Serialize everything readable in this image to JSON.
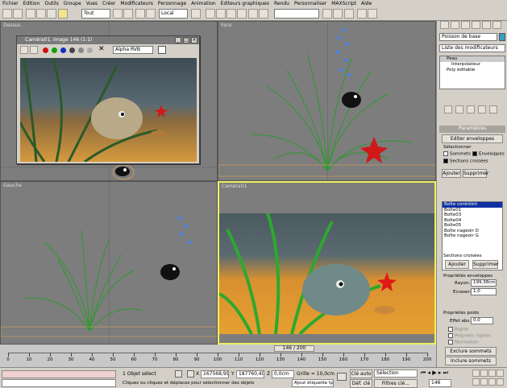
{
  "menu": [
    "Fichier",
    "Edition",
    "Outils",
    "Groupe",
    "Vues",
    "Créer",
    "Modificateurs",
    "Personnage",
    "Animation",
    "Editeurs graphiques",
    "Rendu",
    "Personnaliser",
    "MAXScript",
    "Aide"
  ],
  "toolbar": {
    "selection_filter": "Tout",
    "coord_system": "Local"
  },
  "viewports": {
    "top_left": "Dessus",
    "top_right": "Face",
    "bottom_left": "Gauche",
    "bottom_right": "Caméra01"
  },
  "render_window": {
    "title": "Caméra01, Image 146 (1:1)",
    "channel": "Alpha RVB"
  },
  "command_panel": {
    "object_name": "Poisson de base",
    "modifier_list": "Liste des modificateurs",
    "stack": [
      "Peau",
      "Interpolateur",
      "Poly éditable"
    ],
    "rollout_params": "Paramètres",
    "edit_envelopes": "Editer enveloppes",
    "select_label": "Sélectionner",
    "chk_vertices": "Sommets",
    "chk_envelopes": "Enveloppes",
    "chk_cross": "Sections croisées",
    "add_btn": "Ajouter",
    "remove_btn": "Supprimer",
    "bones": [
      "Boîte contrôlch",
      "Boîte01",
      "Boîte03",
      "Boîte04",
      "Boîte05",
      "Boîte nageoir D",
      "Boîte nageoir G"
    ],
    "cross_sections_label": "Sections croisées",
    "cross_add": "Ajouter",
    "cross_remove": "Supprimer",
    "env_props": "Propriétés enveloppes",
    "radius_label": "Rayon:",
    "radius_value": "199,38cm",
    "squash_label": "Ecraser:",
    "squash_value": "1,0",
    "weight_props": "Propriétés poids",
    "abs_effect": "Effet abs.:",
    "abs_value": "0,0",
    "rigid": "Rigide",
    "rigid_handles": "Poignées rigides",
    "normalize": "Normaliser",
    "exclude_vertices": "Exclure sommets",
    "include_vertices": "Inclure sommets"
  },
  "timeline": {
    "frame_display": "146 / 200",
    "ticks": [
      "0",
      "10",
      "20",
      "30",
      "40",
      "50",
      "60",
      "70",
      "80",
      "90",
      "100",
      "110",
      "120",
      "130",
      "140",
      "150",
      "160",
      "170",
      "180",
      "190",
      "200"
    ]
  },
  "status": {
    "selection_count": "1 Objet sélect",
    "x_label": "X",
    "x_value": "167568,99",
    "y_label": "Y",
    "y_value": "187760,40",
    "z_label": "Z",
    "z_value": "0,0cm",
    "grid": "Grille = 10,0cm",
    "prompt": "Cliquez ou cliquez et déplacez pour sélectionner des objets",
    "add_time_tag": "Ajout étiquette tps",
    "auto_key": "Clé auto",
    "set_key": "Déf. clé",
    "key_mode": "Sélection",
    "key_filters": "Filtres clé...",
    "current_frame": "146"
  }
}
